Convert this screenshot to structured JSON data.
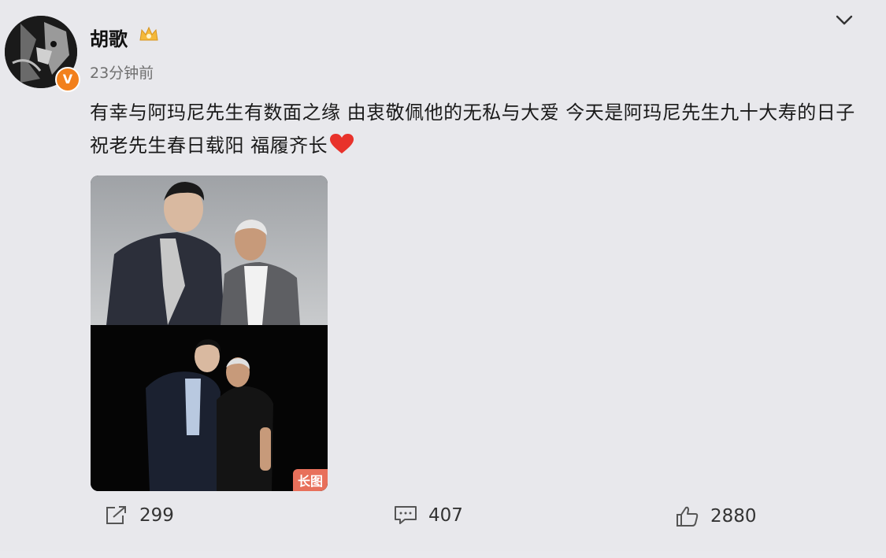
{
  "post": {
    "username": "胡歌",
    "verified_badge": "V",
    "time": "23分钟前",
    "text": "有幸与阿玛尼先生有数面之缘 由衷敬佩他的无私与大爱 今天是阿玛尼先生九十大寿的日子 祝老先生春日载阳 福履齐长",
    "image_badge": "长图",
    "icons": {
      "avatar": "avatar-image",
      "crown": "crown-icon",
      "menu": "chevron-down-icon",
      "heart": "heart-icon"
    }
  },
  "actions": {
    "share_count": "299",
    "comment_count": "407",
    "like_count": "2880"
  },
  "colors": {
    "background": "#e8e8ec",
    "verified": "#f2801c",
    "heart": "#e8322b",
    "long_image_badge": "#e8705b"
  }
}
